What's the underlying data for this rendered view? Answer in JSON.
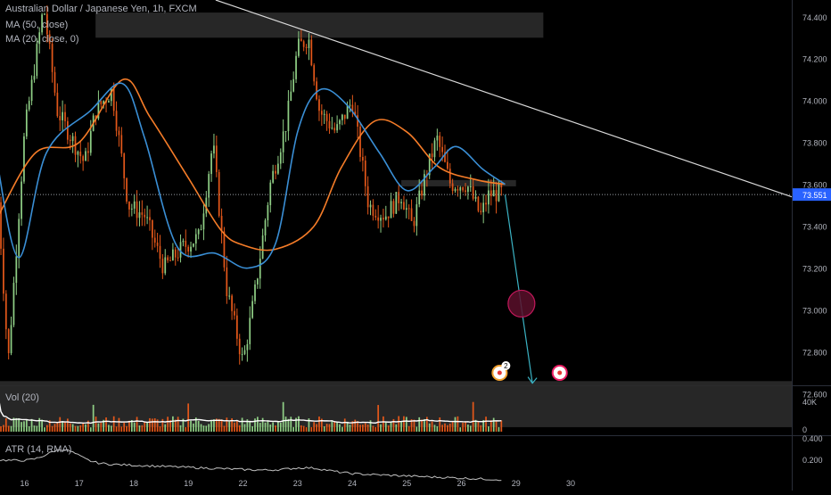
{
  "chart_data": {
    "type": "candlestick",
    "symbol_title": "Australian Dollar / Japanese Yen, 1h, FXCM",
    "indicators": {
      "ma50": {
        "label": "MA (50, close)",
        "color": "#f57c28"
      },
      "ma20": {
        "label": "MA (20, close, 0)",
        "color": "#3a8fd6"
      },
      "vol": {
        "label": "Vol (20)",
        "y_ticks": [
          "40K",
          "0"
        ],
        "ymax": 60000
      },
      "atr": {
        "label": "ATR (14, RMA)",
        "y_ticks": [
          "0.400",
          "0.200"
        ],
        "ylim": [
          0.1,
          0.45
        ]
      }
    },
    "price_axis": {
      "ylim": [
        72.64,
        74.48
      ],
      "ticks": [
        72.6,
        72.8,
        73.0,
        73.2,
        73.4,
        73.6,
        73.8,
        74.0,
        74.2,
        74.4
      ]
    },
    "x_axis": {
      "range": [
        15.55,
        30.05
      ],
      "tick_labels": [
        {
          "label": "16",
          "day": 16
        },
        {
          "label": "17",
          "day": 17
        },
        {
          "label": "18",
          "day": 18
        },
        {
          "label": "19",
          "day": 19
        },
        {
          "label": "22",
          "day": 20
        },
        {
          "label": "23",
          "day": 21
        },
        {
          "label": "24",
          "day": 22
        },
        {
          "label": "25",
          "day": 23
        },
        {
          "label": "26",
          "day": 24
        },
        {
          "label": "29",
          "day": 25
        },
        {
          "label": "30",
          "day": 26
        }
      ]
    },
    "last_price": "73.551",
    "ma50_points": [
      [
        15.5,
        73.44
      ],
      [
        16.2,
        73.75
      ],
      [
        17.0,
        73.8
      ],
      [
        17.8,
        74.1
      ],
      [
        18.3,
        73.92
      ],
      [
        19.0,
        73.63
      ],
      [
        19.6,
        73.38
      ],
      [
        20.0,
        73.31
      ],
      [
        20.6,
        73.29
      ],
      [
        21.3,
        73.4
      ],
      [
        21.8,
        73.68
      ],
      [
        22.4,
        73.9
      ],
      [
        23.0,
        73.85
      ],
      [
        23.6,
        73.68
      ],
      [
        24.3,
        73.62
      ],
      [
        24.8,
        73.6
      ]
    ],
    "ma20_points": [
      [
        15.5,
        73.7
      ],
      [
        15.9,
        73.25
      ],
      [
        16.4,
        73.75
      ],
      [
        17.2,
        73.95
      ],
      [
        17.8,
        74.08
      ],
      [
        18.2,
        73.82
      ],
      [
        18.8,
        73.3
      ],
      [
        19.5,
        73.27
      ],
      [
        20.1,
        73.2
      ],
      [
        20.6,
        73.32
      ],
      [
        21.0,
        73.85
      ],
      [
        21.4,
        74.05
      ],
      [
        21.9,
        73.98
      ],
      [
        22.5,
        73.75
      ],
      [
        23.0,
        73.57
      ],
      [
        23.5,
        73.68
      ],
      [
        23.9,
        73.78
      ],
      [
        24.4,
        73.67
      ],
      [
        24.8,
        73.6
      ]
    ],
    "trendline": [
      [
        19.5,
        74.48
      ],
      [
        30.05,
        73.54
      ]
    ],
    "resistance_zone": [
      74.3,
      74.42
    ],
    "support_zone": [
      72.44,
      72.66
    ],
    "current_zone": [
      73.59,
      73.62
    ],
    "projection_arrow": [
      [
        24.8,
        73.55
      ],
      [
        25.3,
        72.65
      ]
    ],
    "target_marker": {
      "day": 25.1,
      "price": 73.03
    },
    "event_badges": [
      {
        "day": 24.7,
        "label": "2"
      },
      {
        "day": 25.8,
        "label": ""
      }
    ]
  }
}
